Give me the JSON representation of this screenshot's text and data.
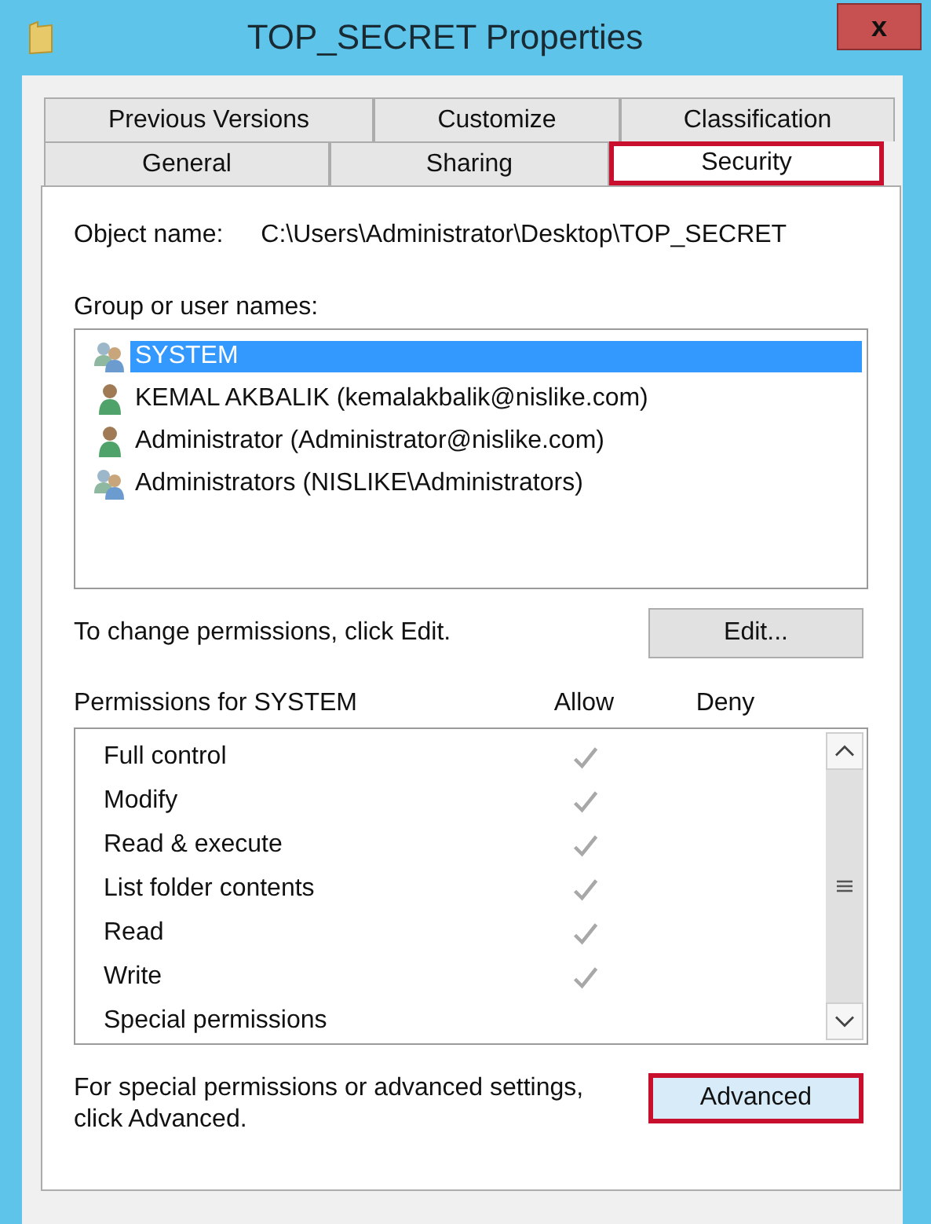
{
  "window": {
    "title": "TOP_SECRET Properties",
    "close": "x"
  },
  "tab_rows": [
    [
      {
        "label": "Previous Versions",
        "selected": false,
        "highlighted": false
      },
      {
        "label": "Customize",
        "selected": false,
        "highlighted": false
      },
      {
        "label": "Classification",
        "selected": false,
        "highlighted": false
      }
    ],
    [
      {
        "label": "General",
        "selected": false,
        "highlighted": false
      },
      {
        "label": "Sharing",
        "selected": false,
        "highlighted": false
      },
      {
        "label": "Security",
        "selected": true,
        "highlighted": true
      }
    ]
  ],
  "object_name": {
    "label": "Object name:",
    "value": "C:\\Users\\Administrator\\Desktop\\TOP_SECRET"
  },
  "group_label": "Group or user names:",
  "users": [
    {
      "kind": "group",
      "name": "SYSTEM",
      "selected": true
    },
    {
      "kind": "user",
      "name": "KEMAL AKBALIK (kemalakbalik@nislike.com)",
      "selected": false
    },
    {
      "kind": "user",
      "name": "Administrator (Administrator@nislike.com)",
      "selected": false
    },
    {
      "kind": "group",
      "name": "Administrators (NISLIKE\\Administrators)",
      "selected": false
    }
  ],
  "edit_hint": "To change permissions, click Edit.",
  "edit_button": {
    "label": "Edit...",
    "highlighted": false
  },
  "permissions_header": {
    "title": "Permissions for SYSTEM",
    "allow": "Allow",
    "deny": "Deny"
  },
  "permissions": [
    {
      "name": "Full control",
      "allow": true,
      "deny": false
    },
    {
      "name": "Modify",
      "allow": true,
      "deny": false
    },
    {
      "name": "Read & execute",
      "allow": true,
      "deny": false
    },
    {
      "name": "List folder contents",
      "allow": true,
      "deny": false
    },
    {
      "name": "Read",
      "allow": true,
      "deny": false
    },
    {
      "name": "Write",
      "allow": true,
      "deny": false
    },
    {
      "name": "Special permissions",
      "allow": false,
      "deny": false
    }
  ],
  "advanced_hint": "For special permissions or advanced settings, click Advanced.",
  "advanced_button": {
    "label": "Advanced",
    "highlighted": true
  }
}
